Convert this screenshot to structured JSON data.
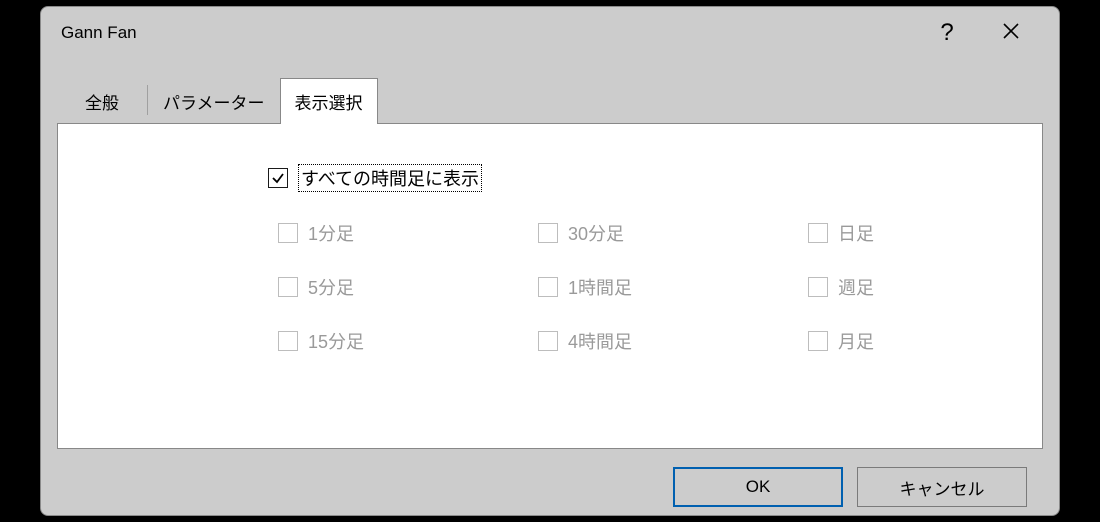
{
  "window": {
    "title": "Gann Fan"
  },
  "tabs": {
    "general": "全般",
    "parameters": "パラメーター",
    "display": "表示選択"
  },
  "panel": {
    "show_all_label": "すべての時間足に表示",
    "show_all_checked": true,
    "timeframes": {
      "m1": "1分足",
      "m5": "5分足",
      "m15": "15分足",
      "m30": "30分足",
      "h1": "1時間足",
      "h4": "4時間足",
      "d1": "日足",
      "w1": "週足",
      "mn1": "月足"
    }
  },
  "buttons": {
    "ok": "OK",
    "cancel": "キャンセル"
  }
}
